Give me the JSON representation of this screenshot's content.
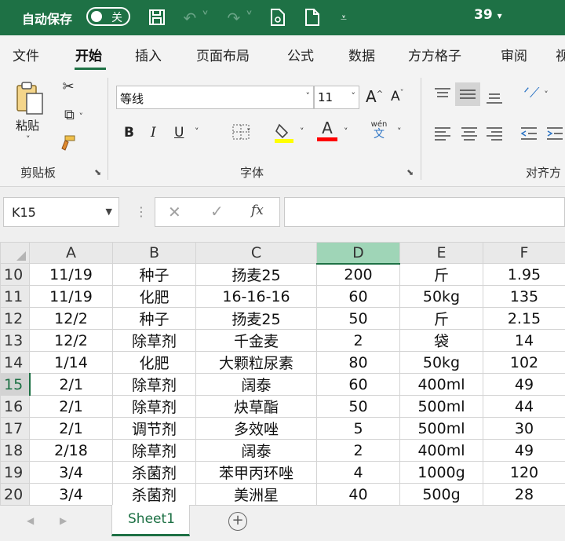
{
  "titlebar": {
    "autosave_label": "自动保存",
    "autosave_state": "关",
    "zoom_value": "39",
    "dropdown_caret": "▾"
  },
  "tabs": [
    {
      "label": "文件"
    },
    {
      "label": "开始"
    },
    {
      "label": "插入"
    },
    {
      "label": "页面布局"
    },
    {
      "label": "公式"
    },
    {
      "label": "数据"
    },
    {
      "label": "方方格子"
    },
    {
      "label": "审阅"
    },
    {
      "label": "视"
    }
  ],
  "ribbon": {
    "paste_label": "粘贴",
    "clipboard_group": "剪贴板",
    "font_group": "字体",
    "align_group": "对齐方",
    "font_name": "等线",
    "font_size": "11",
    "bold": "B",
    "italic": "I",
    "underline": "U",
    "font_color_letter": "A",
    "grow_font": "A",
    "shrink_font": "A",
    "wen_top": "wén",
    "wen_bottom": "文"
  },
  "colors": {
    "accent": "#1e7145",
    "highlight_yellow": "#ffff00",
    "font_red": "#ff0000"
  },
  "formula_bar": {
    "name_box": "K15",
    "formula_value": "",
    "fx": "fx"
  },
  "grid": {
    "columns": [
      "A",
      "B",
      "C",
      "D",
      "E",
      "F"
    ],
    "selected_column": "D",
    "selected_row": "15",
    "rows": [
      {
        "num": "10",
        "cells": [
          "11/19",
          "种子",
          "扬麦25",
          "200",
          "斤",
          "1.95"
        ]
      },
      {
        "num": "11",
        "cells": [
          "11/19",
          "化肥",
          "16-16-16",
          "60",
          "50kg",
          "135"
        ]
      },
      {
        "num": "12",
        "cells": [
          "12/2",
          "种子",
          "扬麦25",
          "50",
          "斤",
          "2.15"
        ]
      },
      {
        "num": "13",
        "cells": [
          "12/2",
          "除草剂",
          "千金麦",
          "2",
          "袋",
          "14"
        ]
      },
      {
        "num": "14",
        "cells": [
          "1/14",
          "化肥",
          "大颗粒尿素",
          "80",
          "50kg",
          "102"
        ]
      },
      {
        "num": "15",
        "cells": [
          "2/1",
          "除草剂",
          "阔泰",
          "60",
          "400ml",
          "49"
        ]
      },
      {
        "num": "16",
        "cells": [
          "2/1",
          "除草剂",
          "炔草酯",
          "50",
          "500ml",
          "44"
        ]
      },
      {
        "num": "17",
        "cells": [
          "2/1",
          "调节剂",
          "多效唑",
          "5",
          "500ml",
          "30"
        ]
      },
      {
        "num": "18",
        "cells": [
          "2/18",
          "除草剂",
          "阔泰",
          "2",
          "400ml",
          "49"
        ]
      },
      {
        "num": "19",
        "cells": [
          "3/4",
          "杀菌剂",
          "苯甲丙环唑",
          "4",
          "1000g",
          "120"
        ]
      },
      {
        "num": "20",
        "cells": [
          "3/4",
          "杀菌剂",
          "美洲星",
          "40",
          "500g",
          "28"
        ]
      }
    ]
  },
  "sheets": {
    "active": "Sheet1",
    "add_symbol": "+"
  }
}
